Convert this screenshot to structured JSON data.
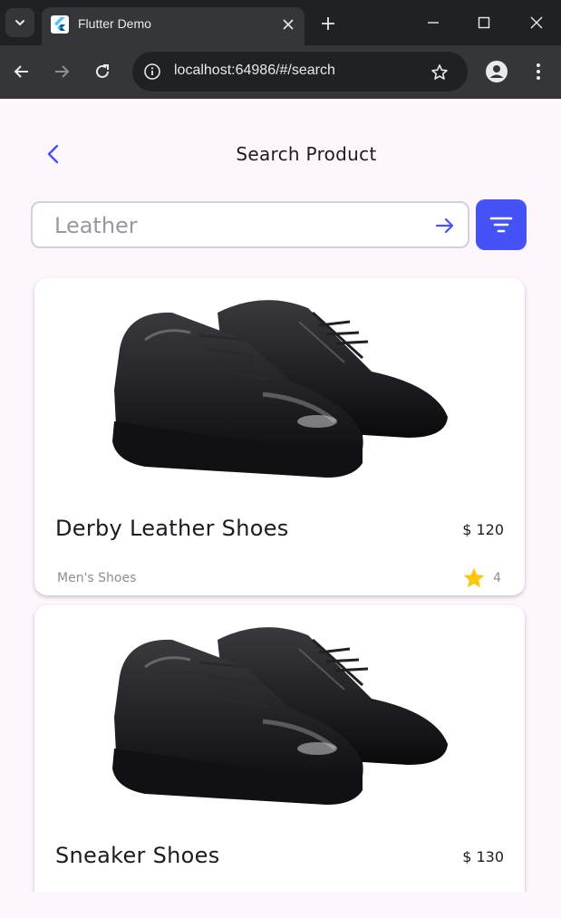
{
  "browser": {
    "tab_title": "Flutter Demo",
    "url": "localhost:64986/#/search"
  },
  "app": {
    "page_title": "Search Product",
    "search": {
      "placeholder": "Leather",
      "value": ""
    },
    "products": [
      {
        "name": "Derby Leather Shoes",
        "price": "$ 120",
        "category": "Men's Shoes",
        "rating": "4"
      },
      {
        "name": "Sneaker Shoes",
        "price": "$ 130"
      }
    ]
  },
  "colors": {
    "accent": "#4452f6",
    "star": "#f9c80e",
    "background": "#fdf7fd",
    "chrome_dark": "#202124",
    "chrome_mid": "#35363a"
  }
}
